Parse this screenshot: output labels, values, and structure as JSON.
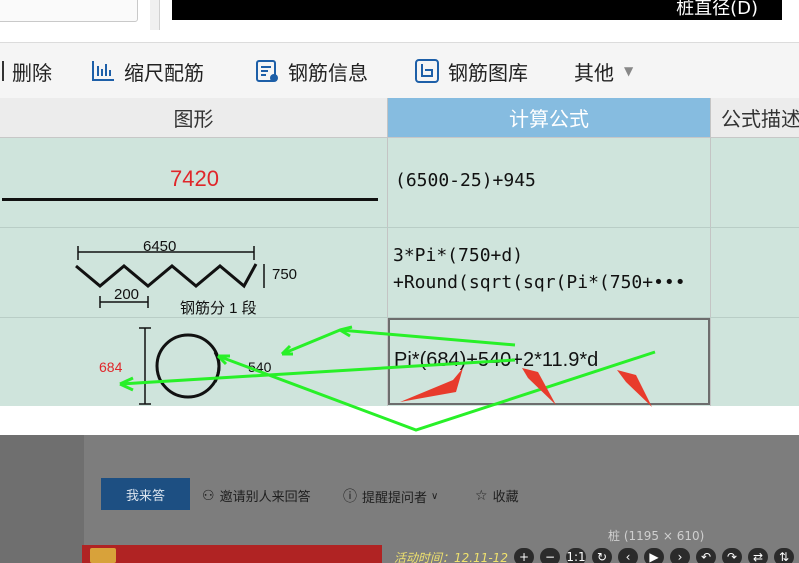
{
  "top_bar": {
    "title_fragment": "桩直径(D)"
  },
  "toolbar": {
    "delete_label": "删除",
    "scale_label": "缩尺配筋",
    "rebar_info_label": "钢筋信息",
    "rebar_library_label": "钢筋图库",
    "other_label": "其他"
  },
  "grid": {
    "headers": {
      "shape": "图形",
      "formula": "计算公式",
      "description": "公式描述"
    },
    "rows": [
      {
        "figure": {
          "length": "7420"
        },
        "formula": "(6500-25)+945"
      },
      {
        "figure": {
          "length": "6450",
          "height": "750",
          "pitch": "200",
          "segments": "钢筋分 1 段"
        },
        "formula_line1": "3*Pi*(750+d)",
        "formula_line2": "+Round(sqrt(sqr(Pi*(750+•••"
      },
      {
        "figure": {
          "diameter": "684",
          "lap": "540"
        },
        "formula": "Pi*(684)+540+2*11.9*d"
      }
    ]
  },
  "qa_bar": {
    "answer_button": "我来答",
    "invite": "邀请别人来回答",
    "remind": "提醒提问者",
    "favorite": "收藏"
  },
  "viewer": {
    "image_size": "桩 (1195 × 610)"
  },
  "promo": {
    "text": "活动时间：12.11-12"
  },
  "viewer_controls": [
    "+",
    "−",
    "1:1",
    "↻",
    "‹",
    "▶",
    "›",
    "↶",
    "↷",
    "⇄",
    "⇅"
  ],
  "colors": {
    "accent_header": "#86bce0",
    "cell_bg": "#cfe4dc",
    "annotation": "#28f028",
    "figure_red": "#e0262a",
    "answer_button": "#1d4f82"
  }
}
